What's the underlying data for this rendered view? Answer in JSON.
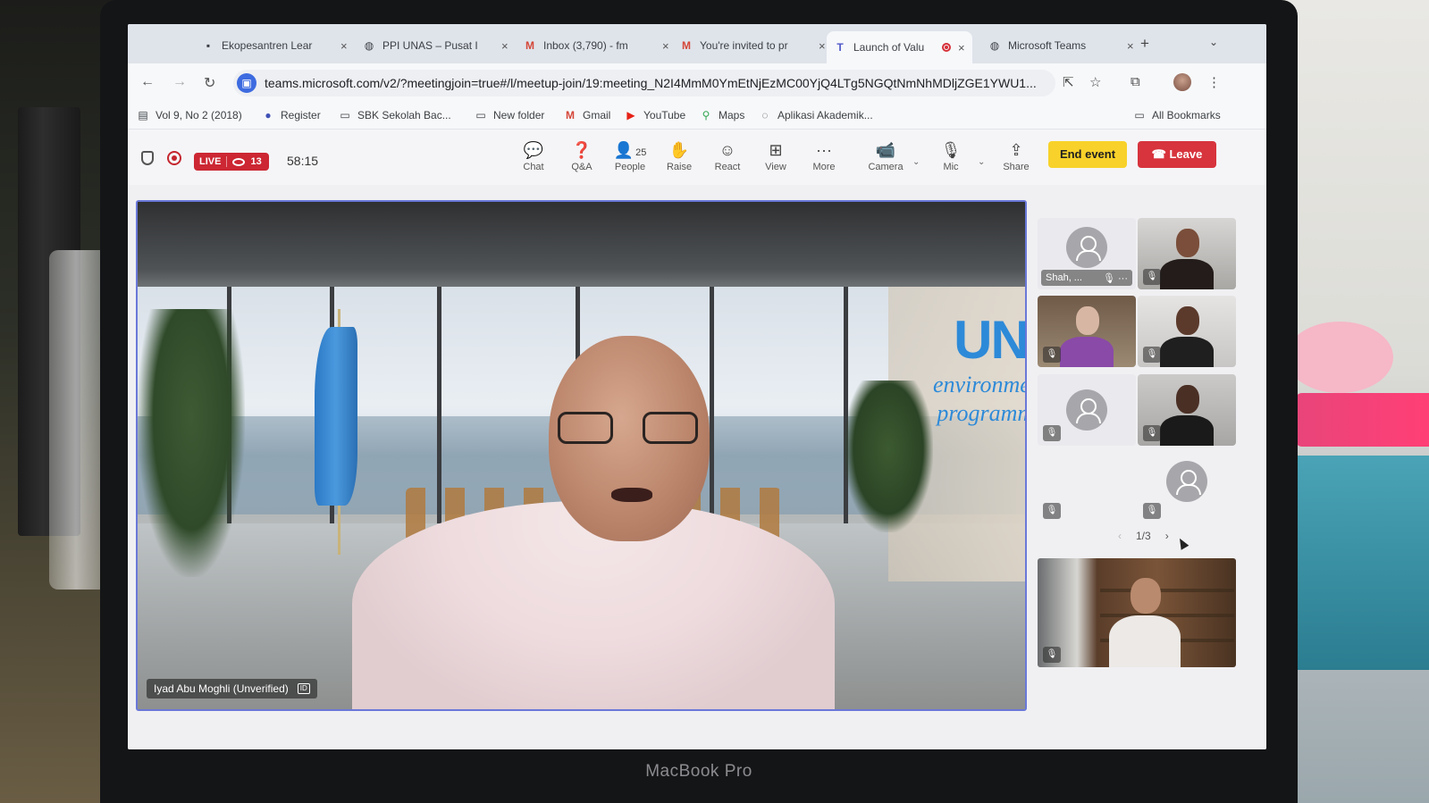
{
  "device_label": "MacBook Pro",
  "browser": {
    "tabs": [
      {
        "icon": "favicon-icon",
        "title": "Ekopesantren Lear",
        "close": "×"
      },
      {
        "icon": "globe-icon",
        "title": "PPI UNAS – Pusat I",
        "close": "×"
      },
      {
        "icon": "gmail-icon",
        "title": "Inbox (3,790) - fm",
        "close": "×"
      },
      {
        "icon": "gmail-icon",
        "title": "You're invited to pr",
        "close": "×"
      },
      {
        "icon": "teams-icon",
        "title": "Launch of Valu",
        "close": "×",
        "active": true,
        "recording": true
      },
      {
        "icon": "globe-icon",
        "title": "Microsoft Teams",
        "close": "×"
      }
    ],
    "new_tab": "+",
    "tab_menu": "⌄",
    "url": "teams.microsoft.com/v2/?meetingjoin=true#/l/meetup-join/19:meeting_N2I4MmM0YmEtNjEzMC00YjQ4LTg5NGQtNmNhMDljZGE1YWU1...",
    "bookmarks": [
      {
        "icon": "doc-icon",
        "label": "Vol 9, No 2 (2018)"
      },
      {
        "icon": "globe-icon",
        "label": "Register"
      },
      {
        "icon": "folder-icon",
        "label": "SBK Sekolah Bac..."
      },
      {
        "icon": "folder-icon",
        "label": "New folder"
      },
      {
        "icon": "gmail-icon",
        "label": "Gmail"
      },
      {
        "icon": "youtube-icon",
        "label": "YouTube"
      },
      {
        "icon": "maps-icon",
        "label": "Maps"
      },
      {
        "icon": "doc-icon",
        "label": "Aplikasi Akademik..."
      }
    ],
    "all_bookmarks": "All Bookmarks"
  },
  "teams": {
    "live_label": "LIVE",
    "viewer_count": "13",
    "timer": "58:15",
    "toolbar": [
      {
        "name": "chat",
        "icon": "chat-icon",
        "label": "Chat"
      },
      {
        "name": "qa",
        "icon": "qa-icon",
        "label": "Q&A"
      },
      {
        "name": "people",
        "icon": "people-icon",
        "label": "People",
        "count": "25"
      },
      {
        "name": "raise",
        "icon": "hand-icon",
        "label": "Raise"
      },
      {
        "name": "react",
        "icon": "smile-icon",
        "label": "React"
      },
      {
        "name": "view",
        "icon": "grid-icon",
        "label": "View"
      },
      {
        "name": "more",
        "icon": "more-icon",
        "label": "More"
      },
      {
        "name": "camera",
        "icon": "camera-icon",
        "label": "Camera"
      },
      {
        "name": "mic",
        "icon": "mic-off-icon",
        "label": "Mic"
      },
      {
        "name": "share",
        "icon": "share-icon",
        "label": "Share"
      }
    ],
    "end_event": "End event",
    "leave": "Leave",
    "main_speaker": "Iyad Abu Moghli (Unverified)",
    "wall_logo": {
      "line1": "UN",
      "line2": "environment",
      "line3": "programme"
    },
    "gallery_tile_name": "Shah, ...",
    "pager": "1/3",
    "colors": {
      "accent": "#6a78d8",
      "live": "#cc2733",
      "end_event": "#f8d22a",
      "leave": "#d7343d",
      "unep_blue": "#2d8ad8"
    }
  }
}
